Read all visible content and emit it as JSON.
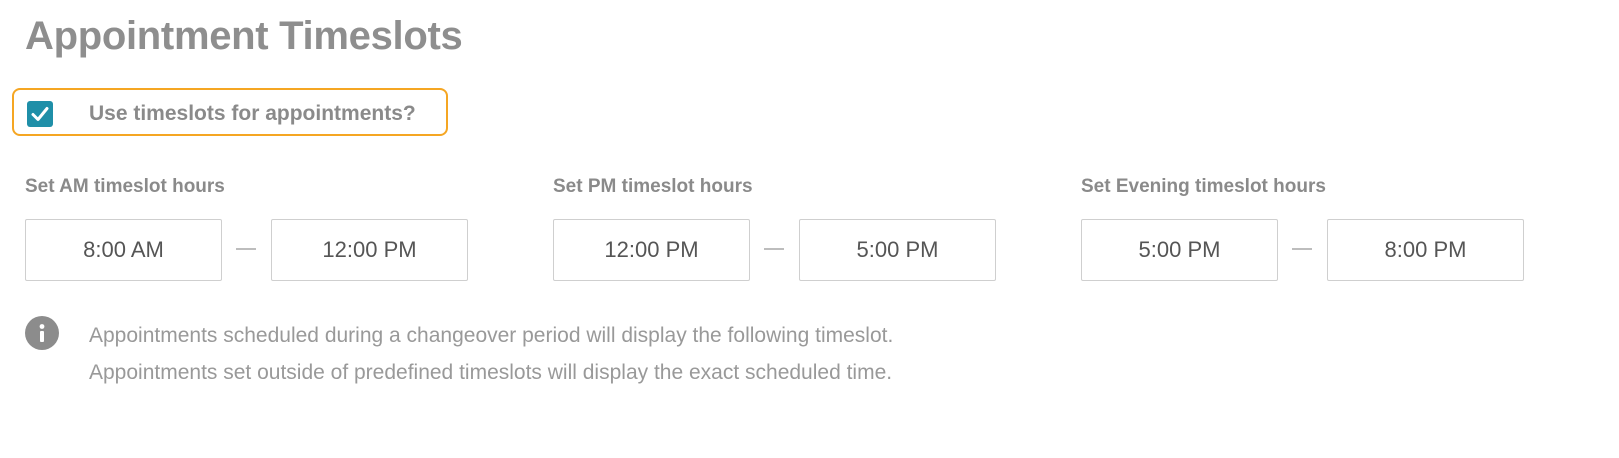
{
  "page": {
    "title": "Appointment Timeslots"
  },
  "use_timeslots": {
    "label": "Use timeslots for appointments?",
    "checked": true
  },
  "timeslots": {
    "am": {
      "label": "Set AM timeslot hours",
      "start": "8:00 AM",
      "end": "12:00 PM"
    },
    "pm": {
      "label": "Set PM timeslot hours",
      "start": "12:00 PM",
      "end": "5:00 PM"
    },
    "evening": {
      "label": "Set Evening timeslot hours",
      "start": "5:00 PM",
      "end": "8:00 PM"
    }
  },
  "info": {
    "icon": "info-icon",
    "line1": "Appointments scheduled during a changeover period will display the following timeslot.",
    "line2": "Appointments set outside of predefined timeslots will display the exact scheduled time."
  },
  "colors": {
    "accent": "#1f8fa8",
    "highlight": "#f5a623"
  }
}
